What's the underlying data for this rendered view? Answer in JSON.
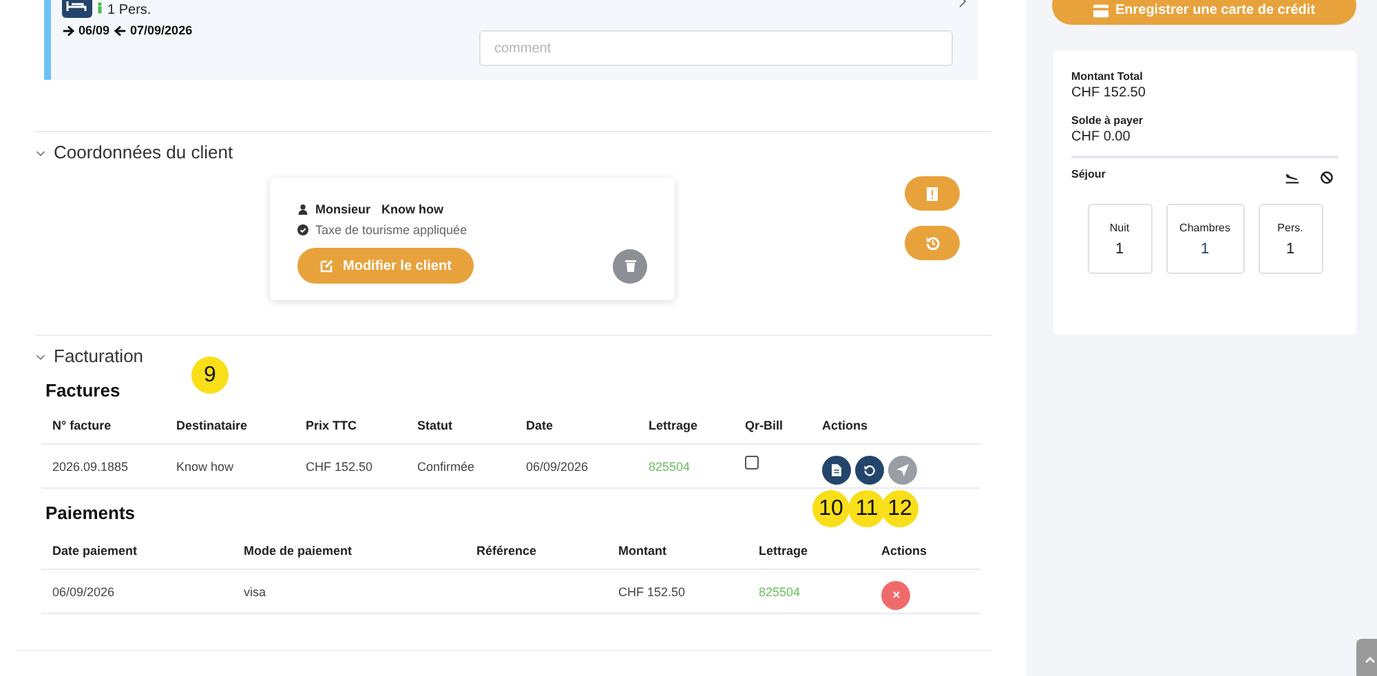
{
  "stay": {
    "persons": "1 Pers.",
    "arrival": "06/09",
    "departure": "07/09/2026",
    "comment": {
      "placeholder": "comment"
    }
  },
  "client_section": {
    "title": "Coordonnées du client",
    "expanded": true,
    "civility": "Monsieur",
    "name": "Know how",
    "tax_note": "Taxe de tourisme appliquée",
    "edit_button": "Modifier le client"
  },
  "billing": {
    "title": "Facturation",
    "expanded": true,
    "invoices": {
      "title": "Factures",
      "columns": [
        "N° facture",
        "Destinataire",
        "Prix TTC",
        "Statut",
        "Date",
        "Lettrage",
        "Qr-Bill",
        "Actions"
      ],
      "rows": [
        {
          "number": "2026.09.1885",
          "recipient": "Know how",
          "price": "CHF 152.50",
          "status": "Confirmée",
          "date": "06/09/2026",
          "lettering": "825504",
          "qr_bill_checked": false,
          "send_disabled": true
        }
      ]
    },
    "payments": {
      "title": "Paiements",
      "columns": [
        "Date paiement",
        "Mode de paiement",
        "Référence",
        "Montant",
        "Lettrage",
        "Actions"
      ],
      "rows": [
        {
          "date": "06/09/2026",
          "mode": "visa",
          "reference": "",
          "amount": "CHF 152.50",
          "lettering": "825504"
        }
      ]
    }
  },
  "summary": {
    "register_card_button": "Enregistrer une carte de crédit",
    "total_label": "Montant Total",
    "total": "CHF 152.50",
    "balance_label": "Solde à payer",
    "balance": "CHF 0.00",
    "stay_label": "Séjour",
    "stats": [
      {
        "label": "Nuit",
        "value": "1"
      },
      {
        "label": "Chambres",
        "value": "1"
      },
      {
        "label": "Pers.",
        "value": "1"
      }
    ]
  },
  "annotations": [
    {
      "label": "9"
    },
    {
      "label": "10"
    },
    {
      "label": "11"
    },
    {
      "label": "12"
    }
  ]
}
